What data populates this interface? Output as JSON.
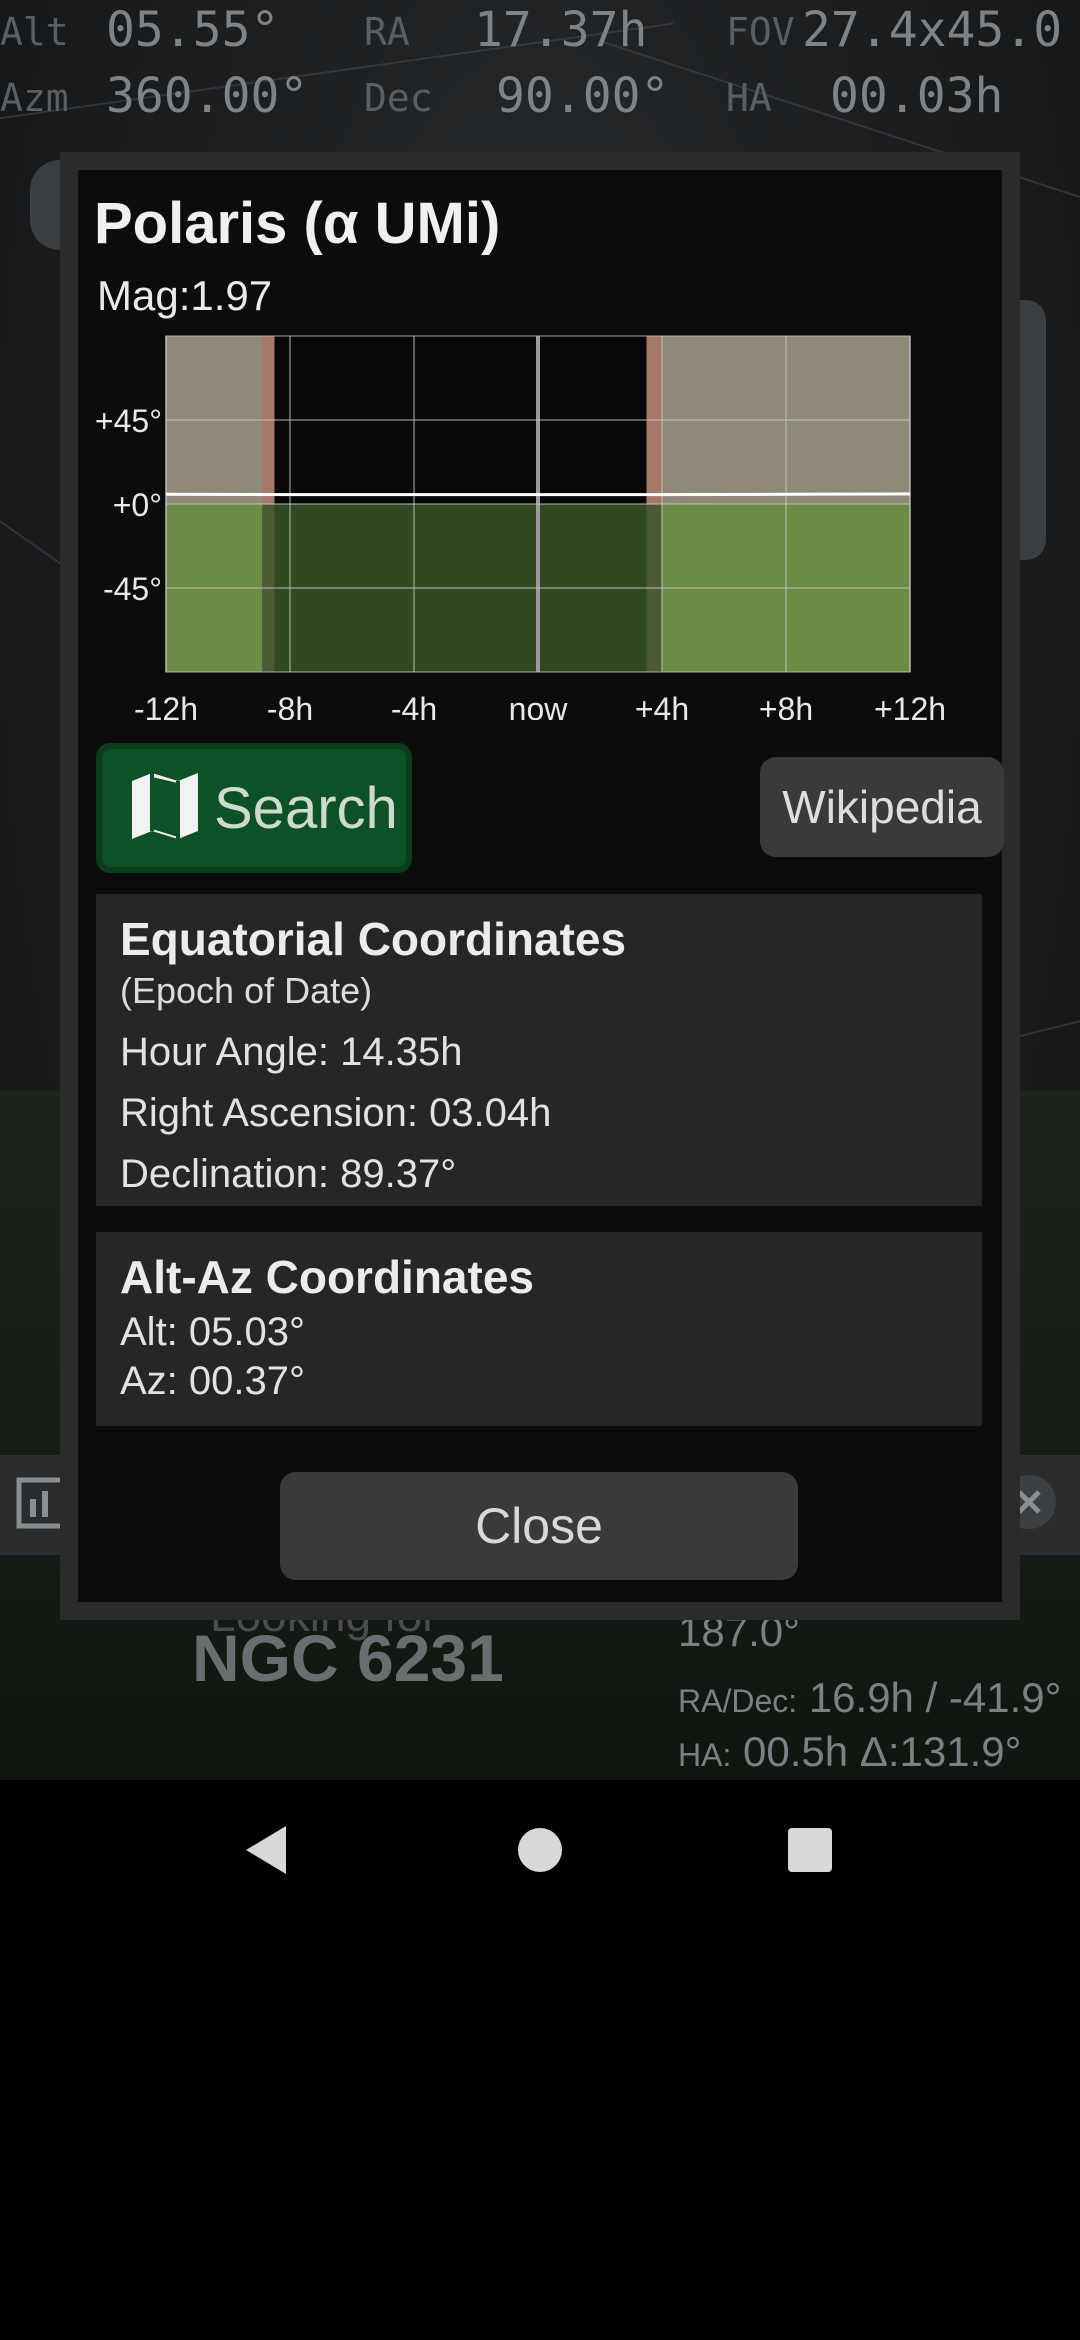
{
  "hud": {
    "alt_label": "Alt",
    "alt_value": "05.55°",
    "ra_label": "RA",
    "ra_value": "17.37h",
    "fov_label": "FOV",
    "fov_value": "27.4x45.0",
    "azm_label": "Azm",
    "azm_value": "360.00°",
    "dec_label": "Dec",
    "dec_value": "90.00°",
    "ha_label": "HA",
    "ha_value": "00.03h"
  },
  "background_status": {
    "looking_for": "Looking for",
    "target": "NGC 6231",
    "az_value": "187.0°",
    "radec_label": "RA/Dec:",
    "radec_value": "16.9h / -41.9°",
    "ha_label": "HA:",
    "ha_value": "00.5h Δ:131.9°"
  },
  "dialog": {
    "title": "Polaris (α UMi)",
    "magnitude": "Mag:1.97",
    "search_label": "Search",
    "wikipedia_label": "Wikipedia",
    "equatorial": {
      "heading": "Equatorial Coordinates",
      "epoch": "(Epoch of Date)",
      "hour_angle": "Hour Angle:  14.35h",
      "right_ascension": "Right Ascension:  03.04h",
      "declination": "Declination:  89.37°"
    },
    "altaz": {
      "heading": "Alt-Az Coordinates",
      "alt": "Alt:  05.03°",
      "az": "Az:  00.37°"
    },
    "close_label": "Close"
  },
  "chart_data": {
    "type": "area",
    "x_ticks": [
      "-12h",
      "-8h",
      "-4h",
      "now",
      "+4h",
      "+8h",
      "+12h"
    ],
    "x_values": [
      -12,
      -8,
      -4,
      0,
      4,
      8,
      12
    ],
    "y_ticks": [
      "+45°",
      "+0°",
      "-45°"
    ],
    "y_values": [
      45,
      0,
      -45
    ],
    "xlim": [
      -12,
      12
    ],
    "ylim": [
      -90,
      90
    ],
    "altitude_line": {
      "x": [
        -12,
        -8,
        -4,
        0,
        4,
        8,
        12
      ],
      "y": [
        5.2,
        5.0,
        5.0,
        5.0,
        5.0,
        5.2,
        5.4
      ]
    },
    "night_interval": [
      -8.5,
      3.5
    ],
    "twilight_intervals": [
      [
        -8.9,
        -8.0
      ],
      [
        3.2,
        4.0
      ]
    ],
    "colors": {
      "day_sky": "#8e8a77",
      "night_sky": "#080808",
      "twilight": "#a6786a",
      "day_ground": "#6a8c45",
      "night_ground": "#2f4a20",
      "altitude_line": "#ffffff"
    }
  },
  "nav": {
    "back": "back-triangle",
    "home": "home-circle",
    "recents": "recents-square"
  }
}
